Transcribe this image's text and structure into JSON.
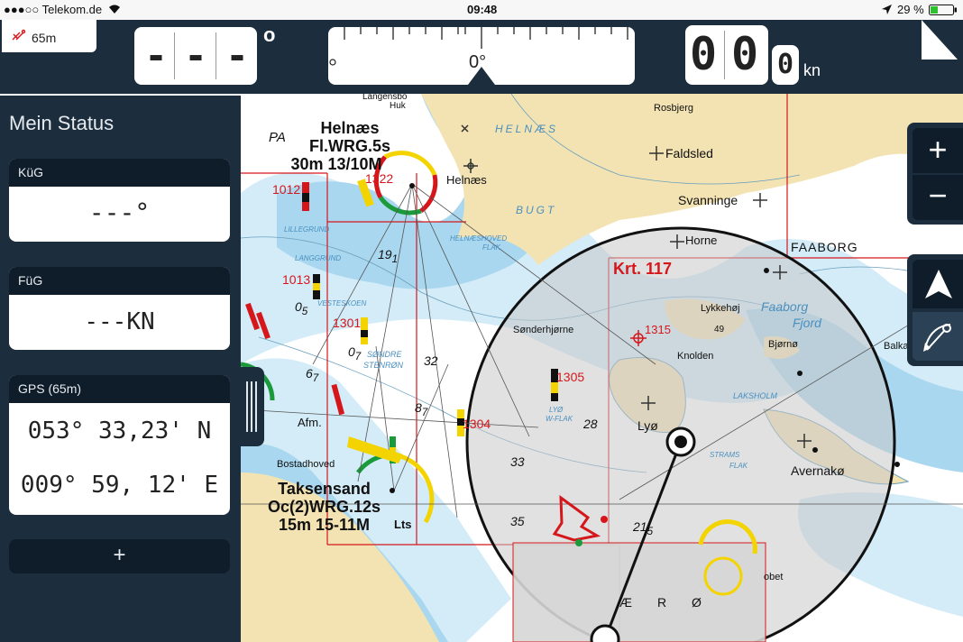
{
  "status_bar": {
    "carrier": "●●●○○ Telekom.de",
    "time": "09:48",
    "battery": "29 %"
  },
  "header": {
    "accuracy": "65m",
    "heading_digits": [
      "-",
      "-",
      "-"
    ],
    "heading_unit": "o",
    "compass_value": "0°",
    "speed_digits": [
      "0",
      "0",
      "0"
    ],
    "speed_unit": "kn"
  },
  "sidebar": {
    "title": "Mein Status",
    "cards": [
      {
        "label": "KüG",
        "value": "---°"
      },
      {
        "label": "FüG",
        "value": "---KN"
      },
      {
        "label": "GPS (65m)",
        "lat": "053° 33,23' N",
        "lon": "009° 59, 12' E"
      }
    ],
    "add_label": "+"
  },
  "controls": {
    "zoom_in": "+",
    "zoom_out": "−"
  },
  "map": {
    "labels": {
      "helnaes_light": "Helnæs",
      "light_char1": "Fl.WRG.5s",
      "light_height1": "30m  13/10M",
      "pa": "PA",
      "langensbo": "Langensbo",
      "huk": "Huk",
      "helnaes_bugt": "HELNÆS",
      "bugt": "BUGT",
      "helnaes_town": "Helnæs",
      "rosbjerg": "Rosbjerg",
      "faldsled": "Faldsled",
      "svanninge": "Svanninge",
      "horne": "Horne",
      "faaborg": "FAABORG",
      "krt": "Krt. 117",
      "lykkehoj": "Lykkehøj",
      "knolden": "Knolden",
      "bjorno": "Bjørnø",
      "faaborg_fjord1": "Faaborg",
      "faaborg_fjord2": "Fjord",
      "balka": "Balka",
      "sonderhjorne": "Sønderhjørne",
      "lyo": "Lyø",
      "avernako": "Avernakø",
      "lakshol": "LAKSHOLM",
      "afm": "Afm.",
      "bostadhoved": "Bostadhoved",
      "taksensand": "Taksensand",
      "light_char2": "Oc(2)WRG.12s",
      "light_height2": "15m  15-11M",
      "lts": "Lts",
      "lillegrund": "LILLEGRUND",
      "langgrund": "LANGGRUND",
      "vestesk": "VESTESKOEN",
      "sondre": "SØNDRE",
      "stenron": "STENRØN",
      "lyo_flak": "LYØ",
      "w_flak": "W-FLAK",
      "strams_flak": "STRAMS",
      "flak": "FLAK",
      "helnaes_flak": "HELNÆSHOVED",
      "flak2": "FLAK",
      "aero_a": "Æ",
      "aero_r": "R",
      "aero_o": "Ø",
      "obet": "obet",
      "n1012": "1012",
      "n1322": "1322",
      "n1013": "1013",
      "n1301": "1301",
      "n1305": "1305",
      "n1304": "1304",
      "n1315": "1315",
      "d19": "19",
      "d19s": "1",
      "d5": "0",
      "d5s": "5",
      "d7": "0",
      "d7s": "7",
      "d6": "6",
      "d6s": "7",
      "d8": "8",
      "d8s": "7",
      "d32": "32",
      "d28": "28",
      "d33": "33",
      "d35": "35",
      "d21": "21",
      "d21s": "5",
      "d49": "49"
    },
    "colors": {
      "land": "#f3e3b2",
      "shallow": "#a9d7ef",
      "mid": "#d3ecf8",
      "water": "#ffffff",
      "red": "#d5171c",
      "dim": "#c8c8c8"
    }
  }
}
